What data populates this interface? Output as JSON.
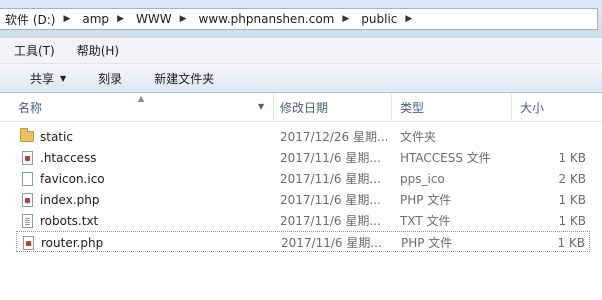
{
  "breadcrumb": {
    "items": [
      {
        "label": "软件 (D:)"
      },
      {
        "label": "amp"
      },
      {
        "label": "WWW"
      },
      {
        "label": "www.phpnanshen.com"
      },
      {
        "label": "public"
      }
    ],
    "separator": "▶"
  },
  "menubar": {
    "tools": "工具(T)",
    "help": "帮助(H)"
  },
  "toolbar": {
    "share": "共享",
    "burn": "刻录",
    "new_folder": "新建文件夹"
  },
  "columns": {
    "name": "名称",
    "date": "修改日期",
    "type": "类型",
    "size": "大小"
  },
  "files": [
    {
      "name": "static",
      "date": "2017/12/26 星期...",
      "type": "文件夹",
      "size": "",
      "icon": "folder-icon"
    },
    {
      "name": ".htaccess",
      "date": "2017/11/6 星期...",
      "type": "HTACCESS 文件",
      "size": "1 KB",
      "icon": "file-icon"
    },
    {
      "name": "favicon.ico",
      "date": "2017/11/6 星期...",
      "type": "pps_ico",
      "size": "2 KB",
      "icon": "file-icon"
    },
    {
      "name": "index.php",
      "date": "2017/11/6 星期...",
      "type": "PHP 文件",
      "size": "1 KB",
      "icon": "php-file-icon"
    },
    {
      "name": "robots.txt",
      "date": "2017/11/6 星期...",
      "type": "TXT 文件",
      "size": "1 KB",
      "icon": "text-file-icon"
    },
    {
      "name": "router.php",
      "date": "2017/11/6 星期...",
      "type": "PHP 文件",
      "size": "1 KB",
      "icon": "php-file-icon"
    }
  ]
}
